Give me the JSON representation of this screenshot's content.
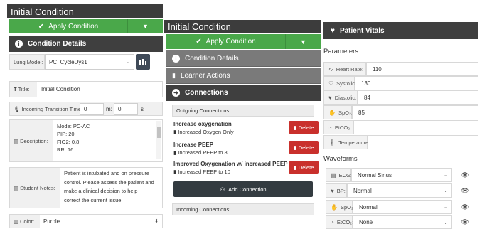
{
  "left": {
    "title": "Initial Condition",
    "apply_label": "Apply Condition",
    "details_header": "Condition Details",
    "lung_model_label": "Lung Model:",
    "lung_model_value": "PC_CycleDys1",
    "title_label": "Title:",
    "title_value": "Initial Condition",
    "incoming_time_label": "Incoming Transition Time:",
    "minutes_value": "0",
    "minutes_unit": "m:",
    "seconds_value": "0",
    "seconds_unit": "s",
    "description_label": "Description:",
    "description_lines": [
      "Mode: PC-AC",
      "PIP: 20",
      "FIO2: 0.8",
      "RR: 16"
    ],
    "student_notes_label": "Student Notes:",
    "student_notes_lines": [
      "Patient is intubated and on pressure",
      "control. Please assess the patient and",
      "make a clinical decision to help",
      "correct the current issue."
    ],
    "color_label": "Color:",
    "color_value": "Purple"
  },
  "middle": {
    "title": "Initial Condition",
    "apply_label": "Apply Condition",
    "sections": [
      "Condition Details",
      "Learner Actions",
      "Connections"
    ],
    "outgoing_label": "Outgoing Connections:",
    "connections": [
      {
        "name": "Increase oxygenation",
        "action": "Increased Oxygen Only",
        "delete_label": "Delete"
      },
      {
        "name": "Increase PEEP",
        "action": "Increased PEEP to 8",
        "delete_label": "Delete"
      },
      {
        "name": "Improved Oxygenation w/ increased PEEP",
        "action": "Increased PEEP to 10",
        "delete_label": "Delete"
      }
    ],
    "add_connection_label": "Add Connection",
    "incoming_label": "Incoming Connections:"
  },
  "right": {
    "header": "Patient Vitals",
    "parameters_title": "Parameters",
    "vitals": [
      {
        "label": "Heart Rate:",
        "value": "110",
        "icon": "heartbeat-icon"
      },
      {
        "label": "Systolic:",
        "value": "130",
        "icon": "heart-outline-icon"
      },
      {
        "label": "Diastolic:",
        "value": "84",
        "icon": "heart-icon"
      },
      {
        "label": "SpO₂:",
        "value": "85",
        "icon": "hand-icon"
      },
      {
        "label": "EtCO₂:",
        "value": "",
        "icon": "gauge-icon"
      },
      {
        "label": "Temperature:",
        "value": "",
        "icon": "thermometer-icon"
      }
    ],
    "waveforms_title": "Waveforms",
    "waveforms": [
      {
        "label": "ECG:",
        "value": "Normal Sinus",
        "icon": "ecg-icon"
      },
      {
        "label": "BP:",
        "value": "Normal",
        "icon": "heart-icon"
      },
      {
        "label": "SpO₂:",
        "value": "Normal",
        "icon": "hand-icon"
      },
      {
        "label": "EtCO₂:",
        "value": "None",
        "icon": "gauge-icon"
      }
    ]
  },
  "colors": {
    "green": "#4aa84a",
    "dark": "#3c3c3c",
    "grey_header": "#7a7a7a",
    "delete_red": "#c9302c",
    "add_dark": "#333b40"
  }
}
